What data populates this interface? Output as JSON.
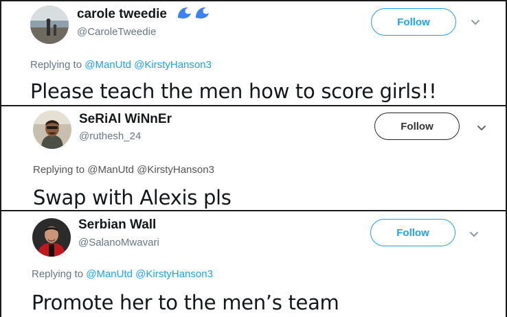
{
  "tweets": [
    {
      "name": "carole tweedie",
      "handle": "@CaroleTweedie",
      "follow_label": "Follow",
      "replying_prefix": "Replying to",
      "mentions": [
        "@ManUtd",
        "@KirstyHanson3"
      ],
      "text": "Please teach the men how to score girls!!",
      "name_emoji": "water-wave-emoji",
      "accent": "#1da1f2"
    },
    {
      "name": "SeRiAl WiNnEr",
      "handle": "@ruthesh_24",
      "follow_label": "Follow",
      "replying_prefix": "Replying to",
      "mentions": [
        "@ManUtd",
        "@KirstyHanson3"
      ],
      "text": "Swap with Alexis pls"
    },
    {
      "name": "Serbian Wall",
      "handle": "@SalanoMwavari",
      "follow_label": "Follow",
      "replying_prefix": "Replying to",
      "mentions": [
        "@ManUtd",
        "@KirstyHanson3"
      ],
      "text": "Promote her to the men’s team",
      "accent": "#1da1f2"
    }
  ]
}
